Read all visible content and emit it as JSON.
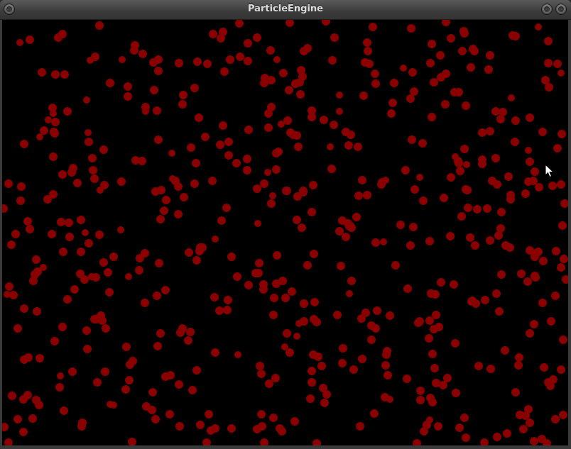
{
  "window": {
    "title": "ParticleEngine"
  },
  "colors": {
    "particle": "#8a0000",
    "canvas_background": "#000000"
  },
  "icons": {
    "left_button": "window-menu-icon",
    "minimize_button": "minimize-icon",
    "close_button": "close-icon",
    "cursor": "mouse-pointer-icon"
  }
}
